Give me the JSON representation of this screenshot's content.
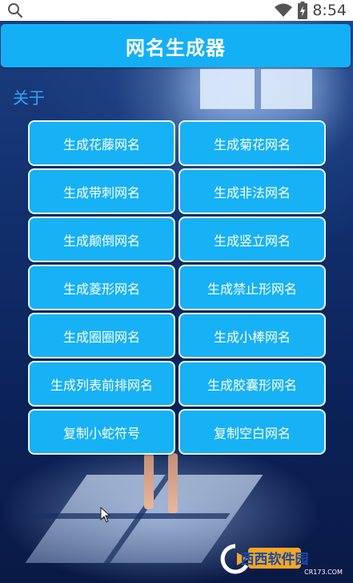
{
  "status_bar": {
    "time": "8:54",
    "icons": [
      "search-icon",
      "wifi-icon",
      "battery-charging-icon"
    ]
  },
  "header": {
    "title": "网名生成器"
  },
  "about": {
    "label": "关于"
  },
  "buttons": [
    "生成花藤网名",
    "生成菊花网名",
    "生成带刺网名",
    "生成非法网名",
    "生成颠倒网名",
    "生成竖立网名",
    "生成菱形网名",
    "生成禁止形网名",
    "生成圈圈网名",
    "生成小棒网名",
    "生成列表前排网名",
    "生成胶囊形网名",
    "复制小蛇符号",
    "复制空白网名"
  ],
  "watermark": {
    "text": "西西软件园",
    "sub": "CR173.COM"
  },
  "colors": {
    "accent": "#14b0f5",
    "link": "#2fa6f8",
    "button_border": "#e6f4ff"
  }
}
